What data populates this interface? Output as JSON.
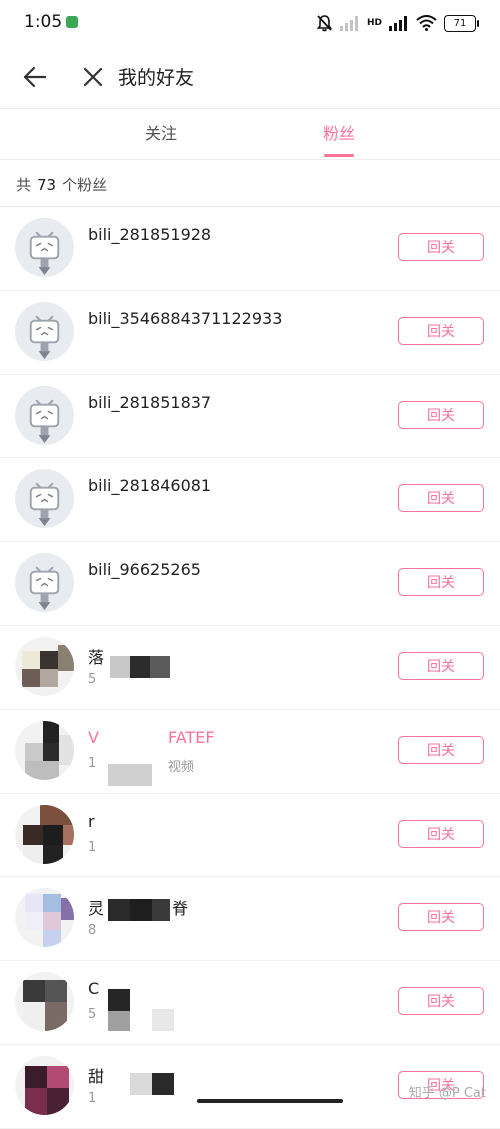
{
  "status_bar": {
    "time": "1:05",
    "network_tag": "HD",
    "battery": "71"
  },
  "header": {
    "title": "我的好友"
  },
  "tabs": [
    {
      "label": "关注",
      "active": false
    },
    {
      "label": "粉丝",
      "active": true
    }
  ],
  "count": {
    "prefix": "共",
    "number": "73",
    "suffix": "个粉丝"
  },
  "fans": [
    {
      "name": "bili_281851928",
      "subtitle": "",
      "follow_label": "回关",
      "avatar": "default-tv-icon"
    },
    {
      "name": "bili_3546884371122933",
      "subtitle": "",
      "follow_label": "回关",
      "avatar": "default-tv-icon"
    },
    {
      "name": "bili_281851837",
      "subtitle": "",
      "follow_label": "回关",
      "avatar": "default-tv-icon"
    },
    {
      "name": "bili_281846081",
      "subtitle": "",
      "follow_label": "回关",
      "avatar": "default-tv-icon"
    },
    {
      "name": "bili_96625265",
      "subtitle": "",
      "follow_label": "回关",
      "avatar": "default-tv-icon"
    },
    {
      "name": "落",
      "subtitle": "5",
      "follow_label": "回关",
      "avatar": "pixelated"
    },
    {
      "name": "V",
      "name_tail": "FATEF",
      "subtitle": "1",
      "subtitle_tail": "视频",
      "follow_label": "回关",
      "avatar": "pixelated"
    },
    {
      "name": "r",
      "subtitle": "1",
      "follow_label": "回关",
      "avatar": "pixelated"
    },
    {
      "name": "灵",
      "name_tail": "脊",
      "subtitle": "8",
      "follow_label": "回关",
      "avatar": "pixelated"
    },
    {
      "name": "C",
      "subtitle": "5",
      "follow_label": "回关",
      "avatar": "pixelated"
    },
    {
      "name": "甜",
      "subtitle": "1",
      "follow_label": "回关",
      "avatar": "pixelated"
    }
  ],
  "watermark": "知乎 @P Cat",
  "colors": {
    "accent": "#fb7299",
    "avatar_bg": "#e8ebf0",
    "divider": "#eeeeee"
  }
}
